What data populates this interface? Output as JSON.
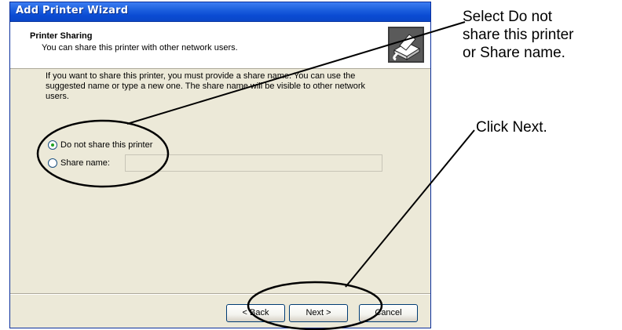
{
  "window": {
    "title": "Add Printer Wizard"
  },
  "header": {
    "title": "Printer Sharing",
    "subtitle": "You can share this printer with other network users.",
    "icon": "printer-share-icon"
  },
  "body": {
    "description_lines": [
      "If you want to share this printer, you must provide a share name. You can use the",
      "suggested name or type a new one. The share name will be visible to other network",
      "users."
    ],
    "options": [
      {
        "label": "Do not share this printer",
        "selected": true
      },
      {
        "label": "Share name:",
        "selected": false
      }
    ],
    "share_name_value": ""
  },
  "buttons": {
    "back": "< Back",
    "next": "Next >",
    "cancel": "Cancel"
  },
  "callouts": {
    "top_lines": [
      "Select Do not",
      "share this printer",
      "or Share name."
    ],
    "bottom": "Click Next."
  },
  "colors": {
    "titlebar": "#0a4bd3",
    "dialog_bg": "#ece9d8",
    "radio_dot": "#21a121"
  }
}
